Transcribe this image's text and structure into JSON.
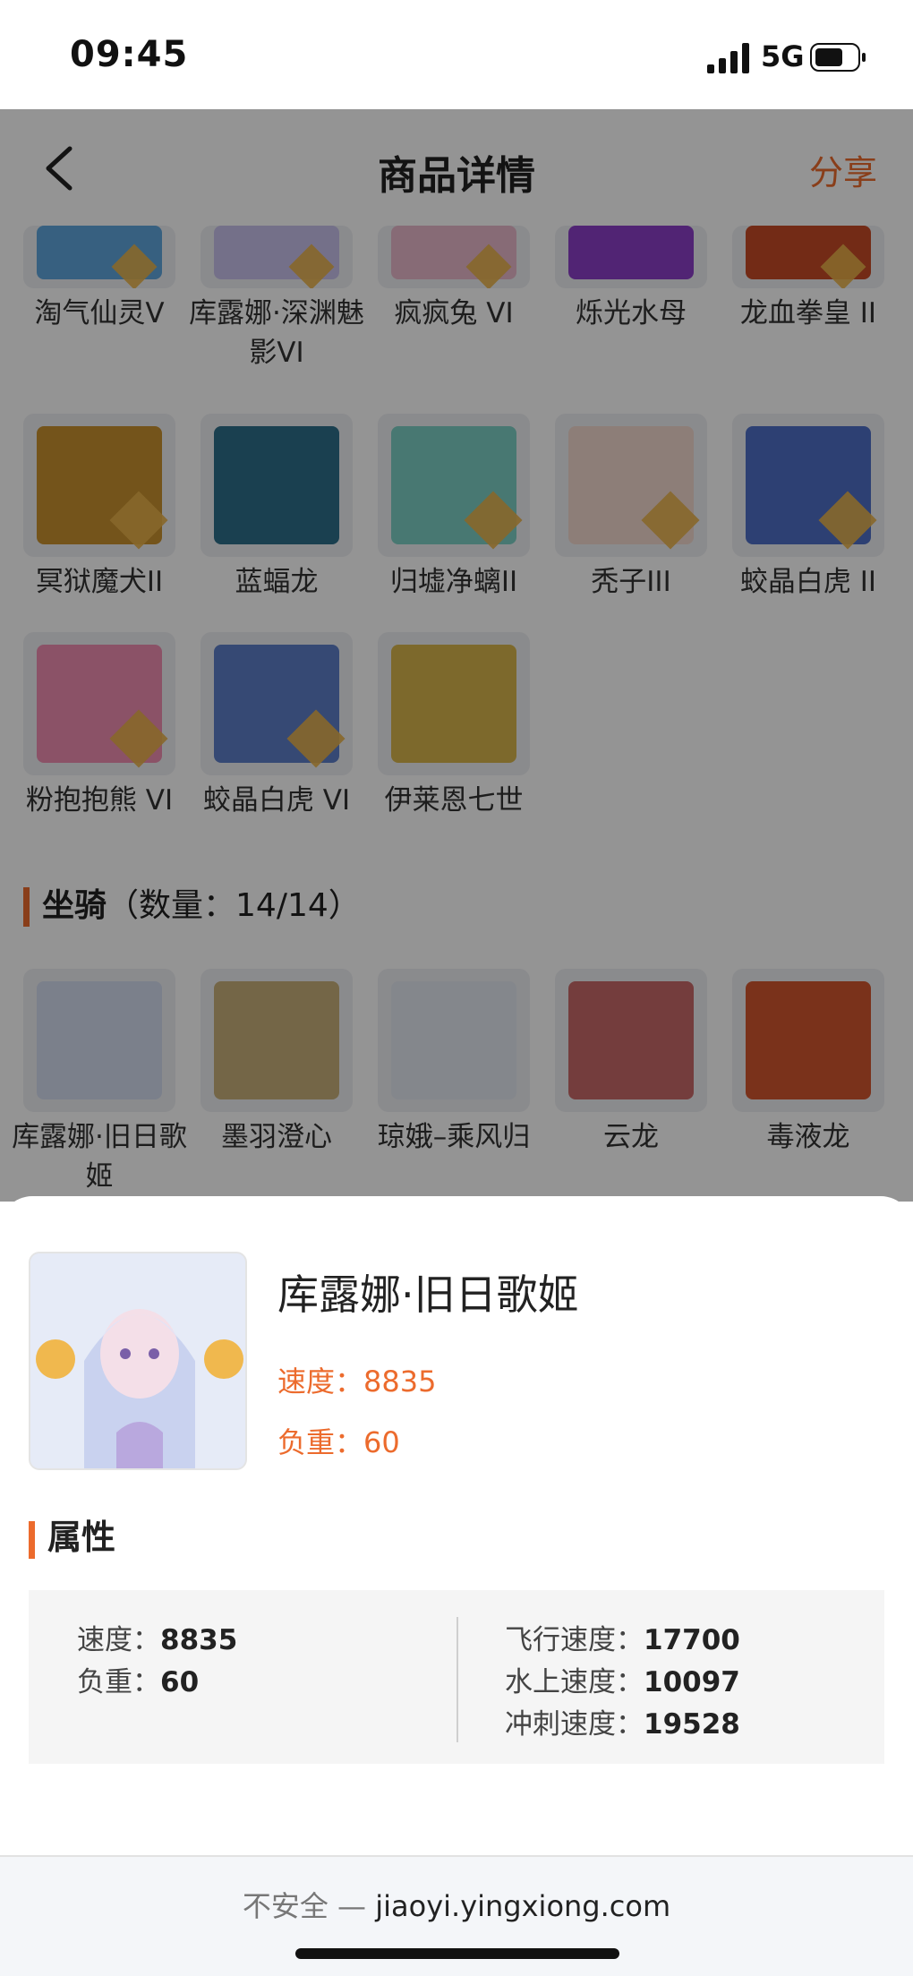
{
  "status_bar": {
    "time": "09:45",
    "network": "5G"
  },
  "header": {
    "title": "商品详情",
    "share_label": "分享"
  },
  "pets": {
    "row1": [
      {
        "name": "淘气仙灵V",
        "level": "V"
      },
      {
        "name": "库露娜·深渊魅影VI",
        "level": "VI"
      },
      {
        "name": "疯疯兔 VI",
        "level": "VI"
      },
      {
        "name": "烁光水母",
        "level": ""
      },
      {
        "name": "龙血拳皇 II",
        "level": "II"
      }
    ],
    "row2": [
      {
        "name": "冥狱魔犬II",
        "level": "II"
      },
      {
        "name": "蓝蝠龙",
        "level": ""
      },
      {
        "name": "归墟净螭II",
        "level": "II"
      },
      {
        "name": "秃子III",
        "level": "III"
      },
      {
        "name": "蛟晶白虎 II",
        "level": "II"
      }
    ],
    "row3": [
      {
        "name": "粉抱抱熊 VI",
        "level": "VI"
      },
      {
        "name": "蛟晶白虎 VI",
        "level": "VI"
      },
      {
        "name": "伊莱恩七世",
        "level": ""
      }
    ]
  },
  "mounts_section": {
    "title": "坐骑",
    "count": "（数量：14/14）"
  },
  "mounts": [
    {
      "name": "库露娜·旧日歌姬"
    },
    {
      "name": "墨羽澄心"
    },
    {
      "name": "琼娥–乘风归"
    },
    {
      "name": "云龙"
    },
    {
      "name": "毒液龙"
    }
  ],
  "detail": {
    "name": "库露娜·旧日歌姬",
    "speed_text": "速度：8835",
    "load_text": "负重：60",
    "attr_title": "属性",
    "attrs_left": [
      {
        "label": "速度：",
        "value": "8835"
      },
      {
        "label": "负重：",
        "value": "60"
      }
    ],
    "attrs_right": [
      {
        "label": "飞行速度：",
        "value": "17700"
      },
      {
        "label": "水上速度：",
        "value": "10097"
      },
      {
        "label": "冲刺速度：",
        "value": "19528"
      }
    ]
  },
  "browser": {
    "insecure_label": "不安全 —",
    "domain": "jiaoyi.yingxiong.com"
  },
  "colors": {
    "accent": "#ec6b2d",
    "level_badge": "#e9b24a"
  }
}
